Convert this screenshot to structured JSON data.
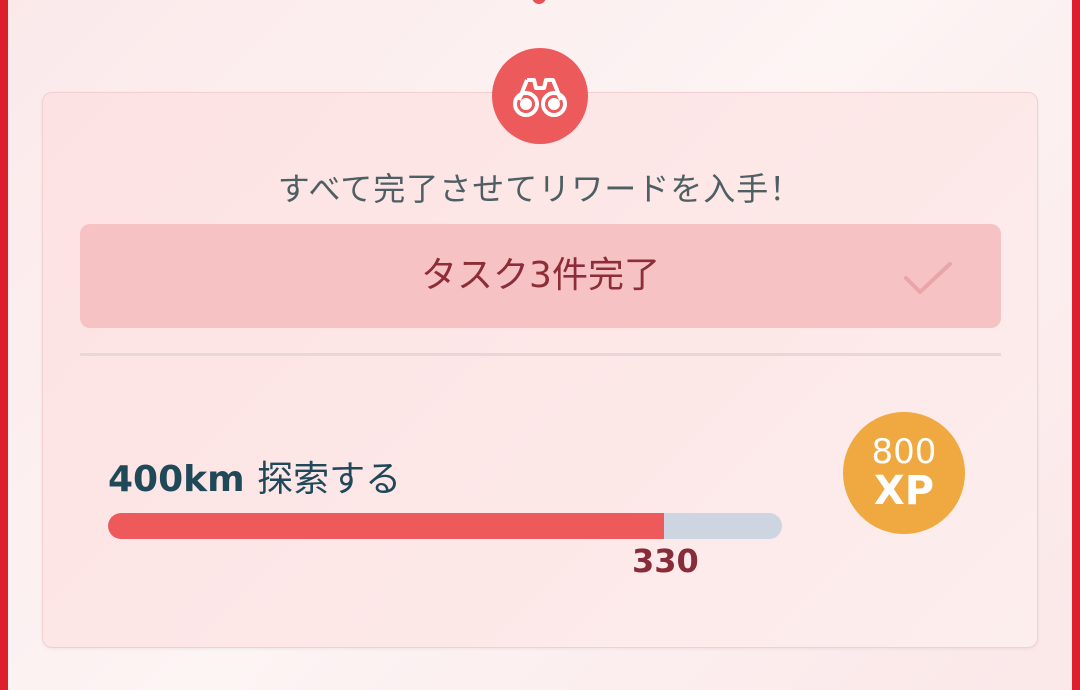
{
  "colors": {
    "frame": "#dc1e2d",
    "badge": "#ec5a5b",
    "task_bar": "#f7c2c3",
    "progress_fill": "#ee595b",
    "progress_track": "#ccd5e0",
    "xp_coin": "#f0a841"
  },
  "header": {
    "badge_icon": "binoculars-icon",
    "subtitle": "すべて完了させてリワードを入手！"
  },
  "task": {
    "label": "タスク3件完了",
    "status_icon": "checkmark-icon",
    "completed": true
  },
  "goal": {
    "distance": "400km",
    "action": "探索する",
    "progress_km": 330,
    "target_km": 400,
    "progress_label": "330"
  },
  "reward": {
    "amount": "800",
    "unit": "XP"
  }
}
